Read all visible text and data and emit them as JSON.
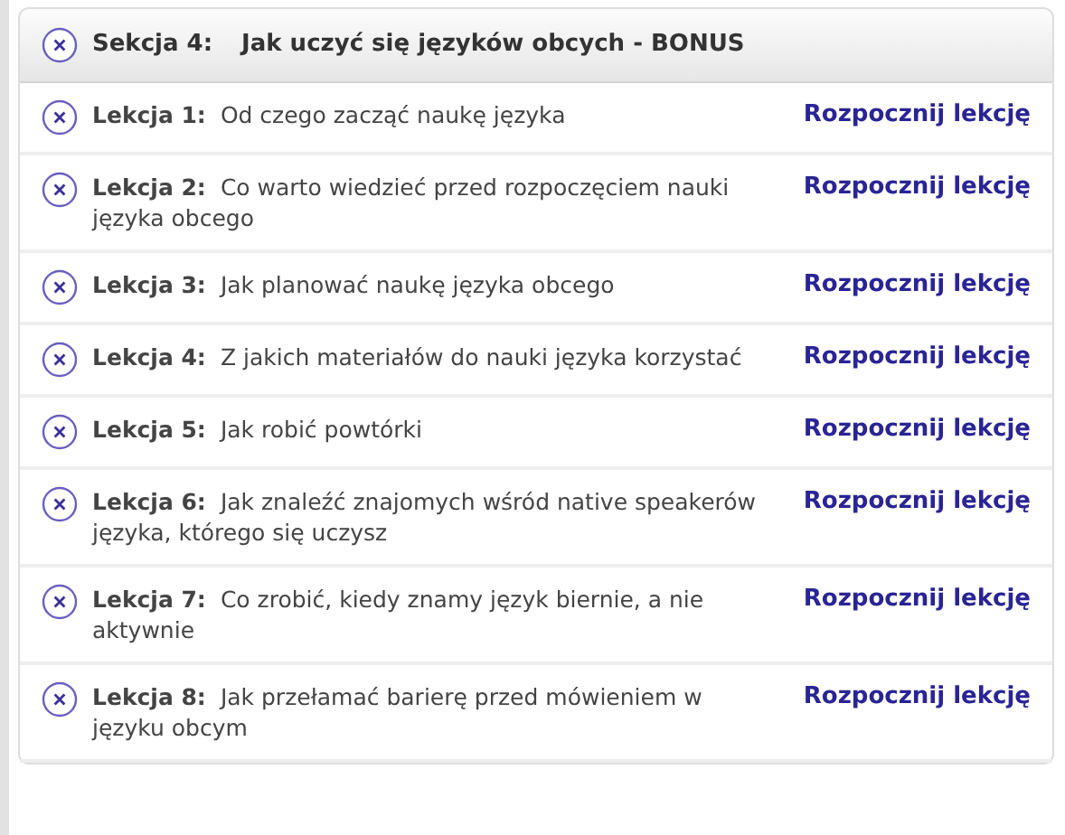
{
  "section": {
    "label": "Sekcja 4:",
    "title": "Jak uczyć się języków obcych - BONUS"
  },
  "lessons": [
    {
      "label": "Lekcja 1:",
      "title": "Od czego zacząć naukę języka",
      "action": "Rozpocznij lekcję"
    },
    {
      "label": "Lekcja 2:",
      "title": "Co warto wiedzieć przed rozpoczęciem nauki języka obcego",
      "action": "Rozpocznij lekcję"
    },
    {
      "label": "Lekcja 3:",
      "title": "Jak planować naukę języka obcego",
      "action": "Rozpocznij lekcję"
    },
    {
      "label": "Lekcja 4:",
      "title": "Z jakich materiałów do nauki języka korzystać",
      "action": "Rozpocznij lekcję"
    },
    {
      "label": "Lekcja 5:",
      "title": "Jak robić powtórki",
      "action": "Rozpocznij lekcję"
    },
    {
      "label": "Lekcja 6:",
      "title": "Jak znaleźć znajomych wśród native speakerów języka, którego się uczysz",
      "action": "Rozpocznij lekcję"
    },
    {
      "label": "Lekcja 7:",
      "title": "Co zrobić, kiedy znamy język biernie, a nie aktywnie",
      "action": "Rozpocznij lekcję"
    },
    {
      "label": "Lekcja 8:",
      "title": "Jak przełamać barierę przed mówieniem w języku obcym",
      "action": "Rozpocznij lekcję"
    }
  ]
}
